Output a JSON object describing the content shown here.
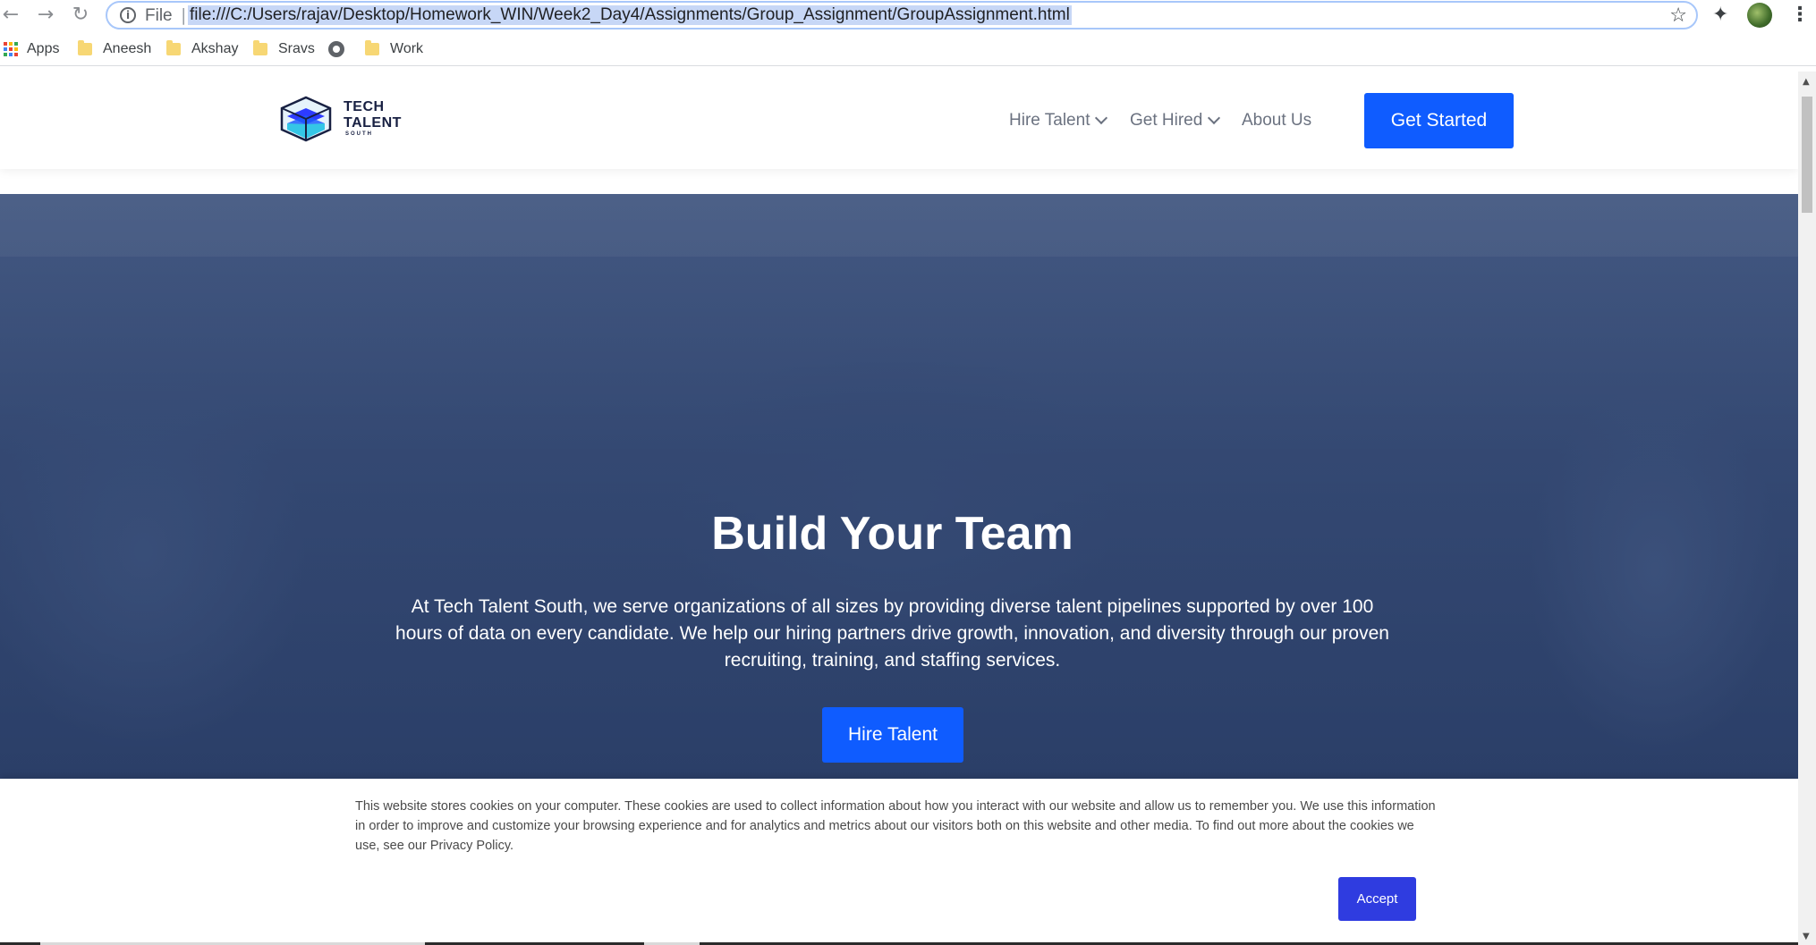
{
  "browser": {
    "file_label": "File",
    "url": "file:///C:/Users/rajav/Desktop/Homework_WIN/Week2_Day4/Assignments/Group_Assignment/GroupAssignment.html",
    "bookmarks": [
      {
        "label": "Apps",
        "icon": "apps-grid-icon"
      },
      {
        "label": "Aneesh",
        "icon": "folder-icon"
      },
      {
        "label": "Akshay",
        "icon": "folder-icon"
      },
      {
        "label": "Sravs",
        "icon": "folder-icon"
      },
      {
        "label": "",
        "icon": "globe-icon"
      },
      {
        "label": "Work",
        "icon": "folder-icon"
      }
    ]
  },
  "header": {
    "logo": {
      "line1": "TECH",
      "line2": "TALENT",
      "line3": "SOUTH"
    },
    "nav": [
      {
        "label": "Hire Talent",
        "has_dropdown": true
      },
      {
        "label": "Get Hired",
        "has_dropdown": true
      },
      {
        "label": "About Us",
        "has_dropdown": false
      }
    ],
    "cta_label": "Get Started"
  },
  "hero": {
    "title": "Build Your Team",
    "description": "At Tech Talent South, we serve organizations of all sizes by providing diverse talent pipelines supported by over 100 hours of data on every candidate. We help our hiring partners drive growth, innovation, and diversity through our proven recruiting, training, and staffing services.",
    "button_label": "Hire Talent"
  },
  "cookie": {
    "text": "This website stores cookies on your computer. These cookies are used to collect information about how you interact with our website and allow us to remember you. We use this information in order to improve and customize your browsing experience and for analytics and metrics about our visitors both on this website and other media. To find out more about the cookies we use, see our Privacy Policy.",
    "accept_label": "Accept"
  },
  "colors": {
    "brand_blue": "#0f5cff",
    "accept_button": "#2f3ce0",
    "hero_overlay": "#233968",
    "logo_text": "#182042"
  }
}
